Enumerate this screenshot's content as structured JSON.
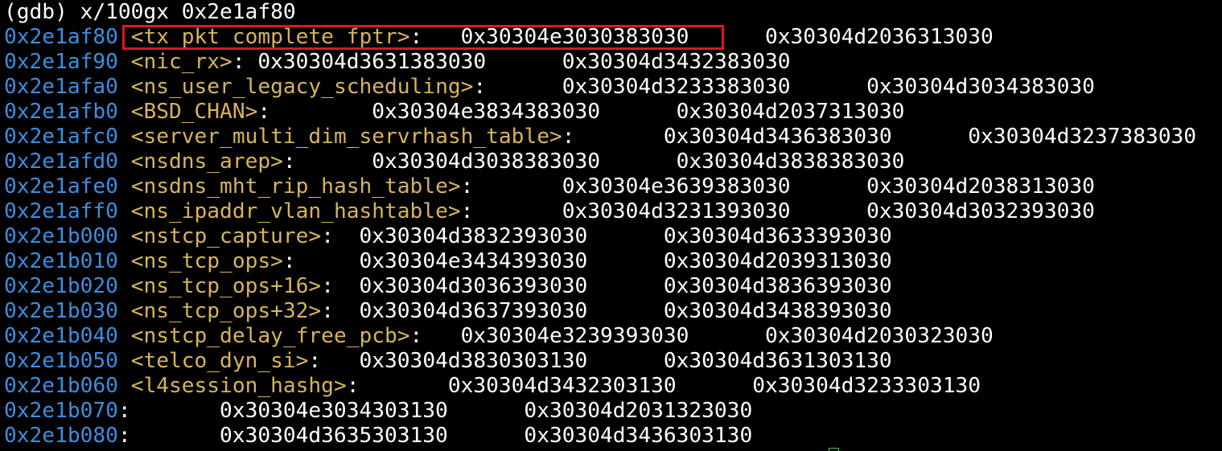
{
  "colors": {
    "background": "#000000",
    "address": "#3b8fe0",
    "symbol": "#d7b45a",
    "text": "#ffffff",
    "highlight_border": "#e0161e",
    "cursor": "#2fd02f"
  },
  "command": "(gdb) x/100gx 0x2e1af80",
  "rows": [
    {
      "addr": "0x2e1af80",
      "pre": " ",
      "sym": "<tx_pkt_complete_fptr>",
      "post": ":   0x30304e3030383030      0x30304d2036313030"
    },
    {
      "addr": "0x2e1af90",
      "pre": " ",
      "sym": "<nic_rx>",
      "post": ": 0x30304d3631383030      0x30304d3432383030"
    },
    {
      "addr": "0x2e1afa0",
      "pre": " ",
      "sym": "<ns_user_legacy_scheduling>",
      "post": ":      0x30304d3233383030      0x30304d3034383030"
    },
    {
      "addr": "0x2e1afb0",
      "pre": " ",
      "sym": "<BSD_CHAN>",
      "post": ":        0x30304e3834383030      0x30304d2037313030"
    },
    {
      "addr": "0x2e1afc0",
      "pre": " ",
      "sym": "<server_multi_dim_servrhash_table>",
      "post": ":       0x30304d3436383030      0x30304d3237383030"
    },
    {
      "addr": "0x2e1afd0",
      "pre": " ",
      "sym": "<nsdns_arep>",
      "post": ":      0x30304d3038383030      0x30304d3838383030"
    },
    {
      "addr": "0x2e1afe0",
      "pre": " ",
      "sym": "<nsdns_mht_rip_hash_table>",
      "post": ":       0x30304e3639383030      0x30304d2038313030"
    },
    {
      "addr": "0x2e1aff0",
      "pre": " ",
      "sym": "<ns_ipaddr_vlan_hashtable>",
      "post": ":       0x30304d3231393030      0x30304d3032393030"
    },
    {
      "addr": "0x2e1b000",
      "pre": " ",
      "sym": "<nstcp_capture>",
      "post": ":  0x30304d3832393030      0x30304d3633393030"
    },
    {
      "addr": "0x2e1b010",
      "pre": " ",
      "sym": "<ns_tcp_ops>",
      "post": ":     0x30304e3434393030      0x30304d2039313030"
    },
    {
      "addr": "0x2e1b020",
      "pre": " ",
      "sym": "<ns_tcp_ops+16>",
      "post": ":  0x30304d3036393030      0x30304d3836393030"
    },
    {
      "addr": "0x2e1b030",
      "pre": " ",
      "sym": "<ns_tcp_ops+32>",
      "post": ":  0x30304d3637393030      0x30304d3438393030"
    },
    {
      "addr": "0x2e1b040",
      "pre": " ",
      "sym": "<nstcp_delay_free_pcb>",
      "post": ":   0x30304e3239393030      0x30304d2030323030"
    },
    {
      "addr": "0x2e1b050",
      "pre": " ",
      "sym": "<telco_dyn_si>",
      "post": ":   0x30304d3830303130      0x30304d3631303130"
    },
    {
      "addr": "0x2e1b060",
      "pre": " ",
      "sym": "<l4session_hashg>",
      "post": ":       0x30304d3432303130      0x30304d3233303130"
    },
    {
      "addr": "0x2e1b070",
      "pre": "",
      "sym": "",
      "post": ":       0x30304e3034303130      0x30304d2031323030"
    },
    {
      "addr": "0x2e1b080",
      "pre": "",
      "sym": "",
      "post": ":       0x30304d3635303130      0x30304d3436303130"
    }
  ]
}
